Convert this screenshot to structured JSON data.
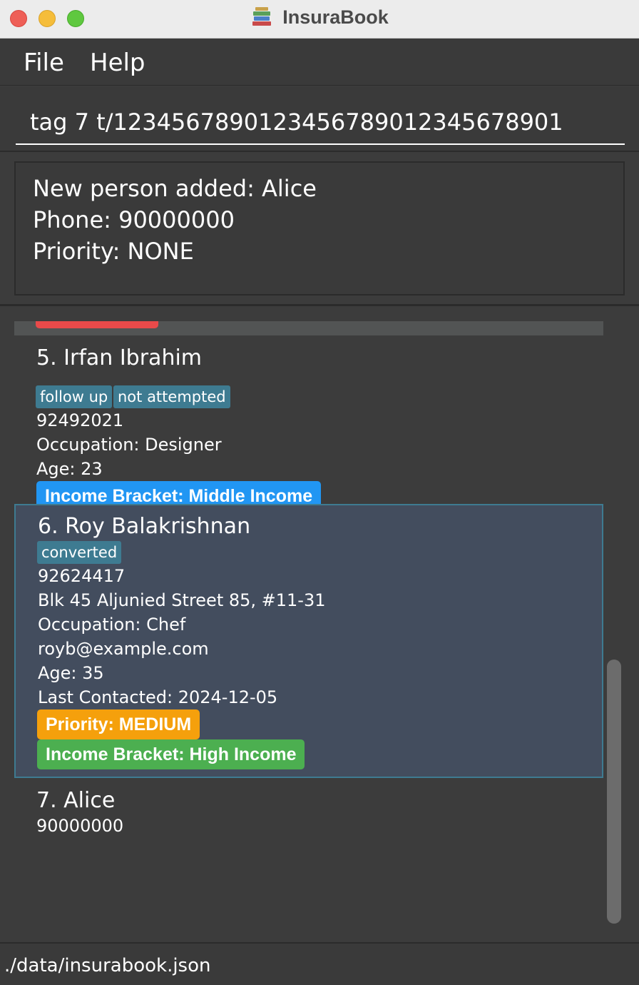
{
  "window": {
    "title": "InsuraBook",
    "app_icon": "book-stack-icon"
  },
  "menu": {
    "items": [
      "File",
      "Help"
    ]
  },
  "command": {
    "value": "tag 7 t/1234567890123456789012345678901"
  },
  "result": {
    "lines": [
      "New person added: Alice",
      "Phone: 90000000",
      "Priority: NONE"
    ]
  },
  "persons": [
    {
      "name": "5. Irfan Ibrahim",
      "tags": [
        "follow up",
        "not attempted"
      ],
      "phone": "92492021",
      "occupation": "Occupation: Designer",
      "age": "Age: 23",
      "income": "Income Bracket: Middle Income"
    },
    {
      "name": "6. Roy Balakrishnan",
      "tags": [
        "converted"
      ],
      "phone": "92624417",
      "address": "Blk 45 Aljunied Street 85, #11-31",
      "occupation": "Occupation: Chef",
      "email": "royb@example.com",
      "age": "Age: 35",
      "last_contacted": "Last Contacted: 2024-12-05",
      "priority": "Priority: MEDIUM",
      "income": "Income Bracket: High Income",
      "selected": true
    },
    {
      "name": "7. Alice",
      "phone": "90000000"
    }
  ],
  "status": {
    "path": "./data/insurabook.json"
  },
  "colors": {
    "tag": "#3e7b91",
    "priority_high_partial": "#e84a4a",
    "priority_medium": "#f5a00c",
    "income_middle": "#2196f3",
    "income_high": "#4caf50",
    "selected_card": "#434d5e"
  }
}
